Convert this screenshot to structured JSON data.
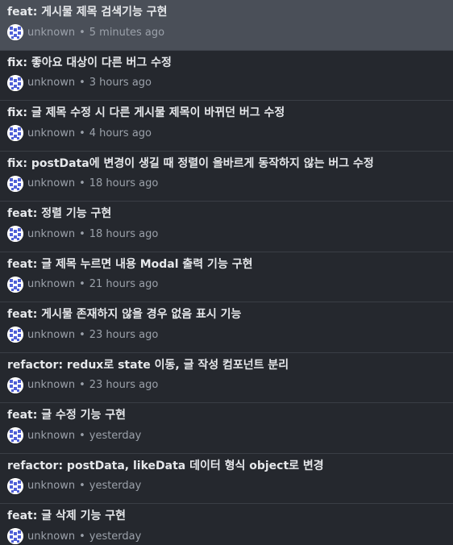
{
  "commits": [
    {
      "subject": "feat: 게시물 제목 검색기능 구현",
      "author": "unknown",
      "separator": "•",
      "time": "5 minutes ago",
      "selected": true
    },
    {
      "subject": "fix: 좋아요 대상이 다른 버그 수정",
      "author": "unknown",
      "separator": "•",
      "time": "3 hours ago"
    },
    {
      "subject": "fix: 글 제목 수정 시 다른 게시물 제목이 바뀌던 버그 수정",
      "author": "unknown",
      "separator": "•",
      "time": "4 hours ago"
    },
    {
      "subject": "fix: postData에 변경이 생길 때 정렬이 올바르게 동작하지 않는 버그 수정",
      "author": "unknown",
      "separator": "•",
      "time": "18 hours ago"
    },
    {
      "subject": "feat: 정렬 기능 구현",
      "author": "unknown",
      "separator": "•",
      "time": "18 hours ago"
    },
    {
      "subject": "feat: 글 제목 누르면 내용 Modal 출력 기능 구현",
      "author": "unknown",
      "separator": "•",
      "time": "21 hours ago"
    },
    {
      "subject": "feat: 게시물 존재하지 않을 경우 없음 표시 기능",
      "author": "unknown",
      "separator": "•",
      "time": "23 hours ago"
    },
    {
      "subject": "refactor: redux로 state 이동, 글 작성 컴포넌트 분리",
      "author": "unknown",
      "separator": "•",
      "time": "23 hours ago"
    },
    {
      "subject": "feat: 글 수정 기능 구현",
      "author": "unknown",
      "separator": "•",
      "time": "yesterday"
    },
    {
      "subject": "refactor: postData, likeData 데이터 형식 object로 변경",
      "author": "unknown",
      "separator": "•",
      "time": "yesterday"
    },
    {
      "subject": "feat: 글 삭제 기능 구현",
      "author": "unknown",
      "separator": "•",
      "time": "yesterday"
    }
  ],
  "avatar_icon": "default-identicon",
  "colors": {
    "background": "#25282e",
    "selected_background": "#4a4f58",
    "subject_text": "#e6e8eb",
    "meta_text": "#9ba1aa",
    "avatar_accent": "#4e5fd6"
  }
}
